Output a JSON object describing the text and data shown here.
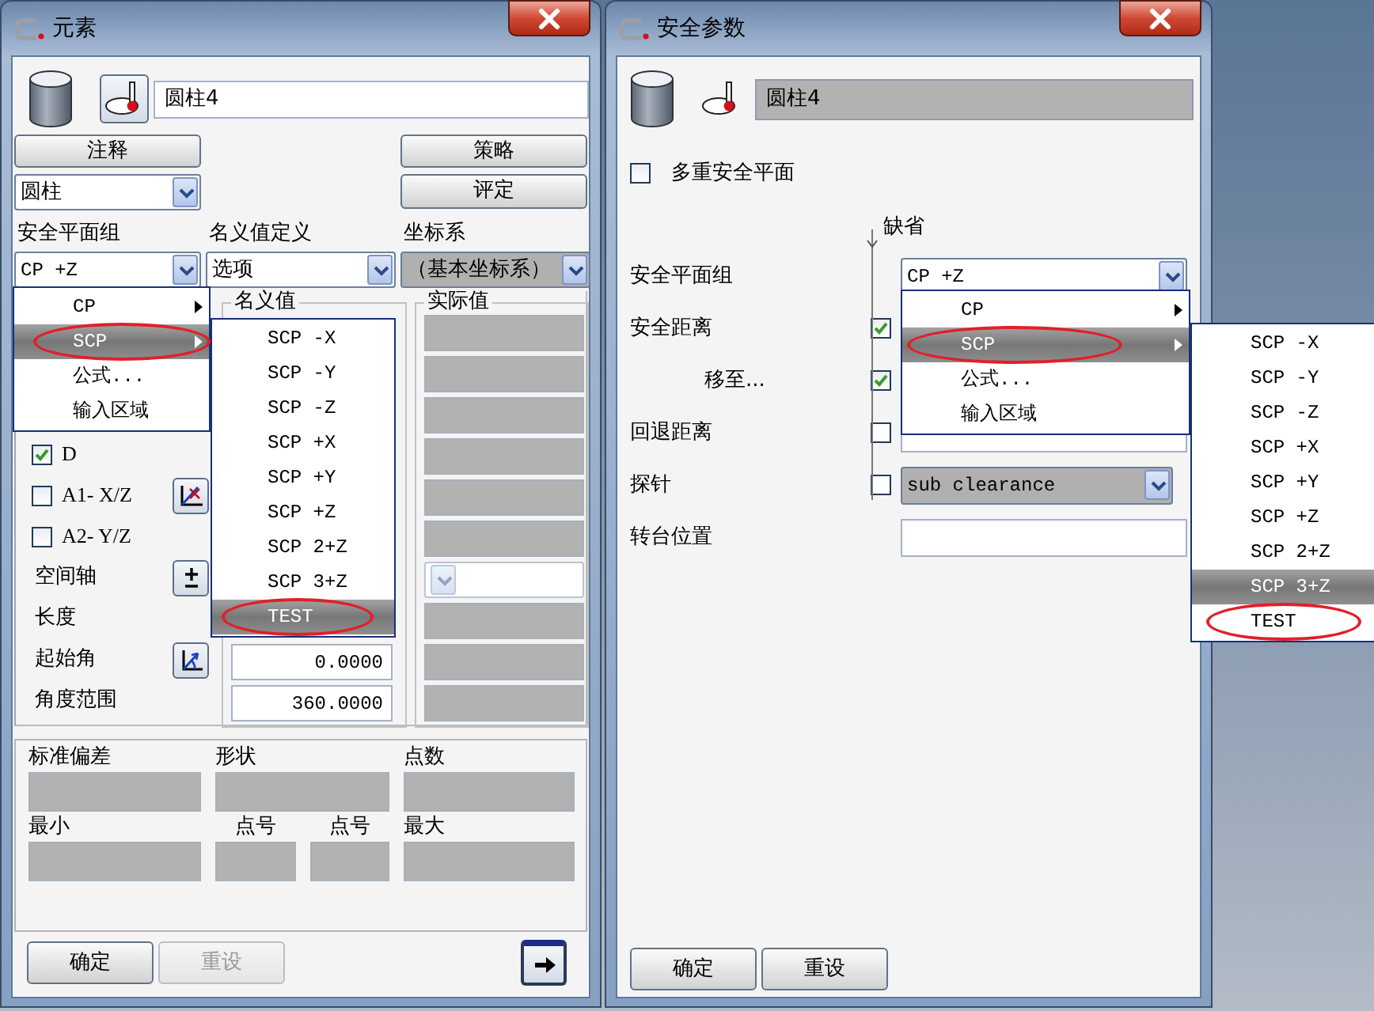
{
  "element_dialog": {
    "title": "元素",
    "name_field": {
      "value": "圆柱4"
    },
    "comment_button": {
      "label": "注释"
    },
    "strategy_button": {
      "label": "策略"
    },
    "type_select": {
      "value": "圆柱"
    },
    "evaluate_button": {
      "label": "评定"
    },
    "selectors": [
      {
        "label": "安全平面组",
        "value": "CP +Z",
        "disabled": false
      },
      {
        "label": "名义值定义",
        "value": "选项",
        "disabled": false
      },
      {
        "label": "坐标系",
        "value": "（基本坐标系）",
        "disabled": true
      }
    ],
    "options": [
      {
        "kind": "check",
        "label": "D",
        "checked": true
      },
      {
        "kind": "check_tool",
        "label": "A1- X/Z",
        "checked": false
      },
      {
        "kind": "check",
        "label": "A2- Y/Z",
        "checked": false
      },
      {
        "kind": "text_tool",
        "label": "空间轴"
      },
      {
        "kind": "text",
        "label": "长度"
      },
      {
        "kind": "text_tool",
        "label": "起始角"
      },
      {
        "kind": "text",
        "label": "角度范围"
      }
    ],
    "nominal": {
      "title": "名义值",
      "values": [
        "0.0000",
        "360.0000"
      ]
    },
    "actual": {
      "title": "实际值",
      "fields": [
        {
          "kind": "readonly"
        },
        {
          "kind": "readonly"
        },
        {
          "kind": "readonly"
        },
        {
          "kind": "readonly"
        },
        {
          "kind": "readonly"
        },
        {
          "kind": "readonly"
        },
        {
          "kind": "select"
        },
        {
          "kind": "readonly"
        },
        {
          "kind": "readonly"
        },
        {
          "kind": "readonly"
        }
      ]
    },
    "statistics": [
      {
        "label": "标准偏差"
      },
      {
        "label": "形状"
      },
      {
        "label": "点数"
      },
      {
        "label": "最小"
      },
      {
        "label": "点号"
      },
      {
        "label": "点号"
      },
      {
        "label": "最大"
      }
    ],
    "footer_buttons": [
      {
        "label": "确定",
        "disabled": false
      },
      {
        "label": "重设",
        "disabled": true
      }
    ],
    "menu": [
      {
        "label": "CP",
        "has_submenu": true,
        "selected": false,
        "circled": false
      },
      {
        "label": "SCP",
        "has_submenu": true,
        "selected": true,
        "circled": true
      },
      {
        "label": "公式...",
        "has_submenu": false,
        "selected": false,
        "circled": false
      },
      {
        "label": "输入区域",
        "has_submenu": false,
        "selected": false,
        "circled": false
      }
    ],
    "submenu": [
      {
        "label": "SCP -X",
        "selected": false,
        "circled": false
      },
      {
        "label": "SCP -Y",
        "selected": false,
        "circled": false
      },
      {
        "label": "SCP -Z",
        "selected": false,
        "circled": false
      },
      {
        "label": "SCP +X",
        "selected": false,
        "circled": false
      },
      {
        "label": "SCP +Y",
        "selected": false,
        "circled": false
      },
      {
        "label": "SCP +Z",
        "selected": false,
        "circled": false
      },
      {
        "label": "SCP 2+Z",
        "selected": false,
        "circled": false
      },
      {
        "label": "SCP 3+Z",
        "selected": false,
        "circled": false
      },
      {
        "label": "TEST",
        "selected": true,
        "circled": true
      }
    ]
  },
  "safety_dialog": {
    "title": "安全参数",
    "name_field": {
      "value": "圆柱4"
    },
    "multiple_planes": {
      "label": "多重安全平面",
      "checked": false
    },
    "default_label": "缺省",
    "rows": [
      {
        "kind": "select",
        "label": "安全平面组",
        "value": "CP +Z"
      },
      {
        "kind": "check",
        "label": "安全距离",
        "checked": true,
        "indented": false
      },
      {
        "kind": "check",
        "label": "移至...",
        "checked": true,
        "indented": true
      },
      {
        "kind": "check_field",
        "label": "回退距离",
        "checked": false
      },
      {
        "kind": "check_select",
        "label": "探针",
        "checked": false,
        "value": "sub clearance",
        "disabled": true
      },
      {
        "kind": "field",
        "label": "转台位置"
      }
    ],
    "footer_buttons": [
      {
        "label": "确定",
        "disabled": false
      },
      {
        "label": "重设",
        "disabled": false
      }
    ],
    "menu": [
      {
        "label": "CP",
        "has_submenu": true,
        "selected": false,
        "circled": false
      },
      {
        "label": "SCP",
        "has_submenu": true,
        "selected": true,
        "circled": true
      },
      {
        "label": "公式...",
        "has_submenu": false,
        "selected": false,
        "circled": false
      },
      {
        "label": "输入区域",
        "has_submenu": false,
        "selected": false,
        "circled": false
      }
    ],
    "submenu": [
      {
        "label": "SCP -X",
        "selected": false,
        "circled": false
      },
      {
        "label": "SCP -Y",
        "selected": false,
        "circled": false
      },
      {
        "label": "SCP -Z",
        "selected": false,
        "circled": false
      },
      {
        "label": "SCP +X",
        "selected": false,
        "circled": false
      },
      {
        "label": "SCP +Y",
        "selected": false,
        "circled": false
      },
      {
        "label": "SCP +Z",
        "selected": false,
        "circled": false
      },
      {
        "label": "SCP 2+Z",
        "selected": false,
        "circled": false
      },
      {
        "label": "SCP 3+Z",
        "selected": true,
        "circled": false
      },
      {
        "label": "TEST",
        "selected": false,
        "circled": true
      }
    ]
  }
}
